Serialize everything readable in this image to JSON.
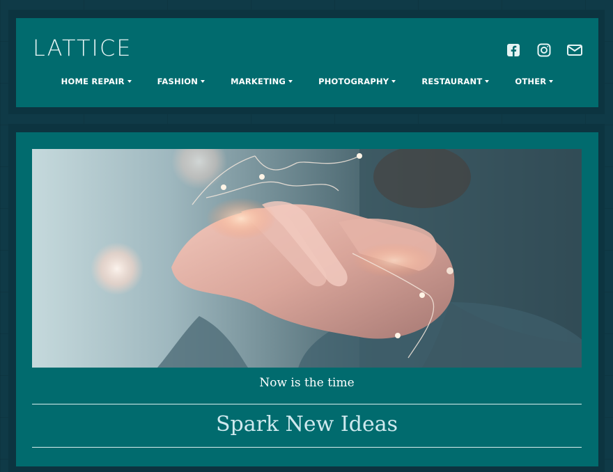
{
  "site": {
    "logo": "LATTICE"
  },
  "social": [
    {
      "icon": "facebook-icon"
    },
    {
      "icon": "instagram-icon"
    },
    {
      "icon": "email-icon"
    }
  ],
  "nav": {
    "items": [
      {
        "label": "HOME REPAIR"
      },
      {
        "label": "FASHION"
      },
      {
        "label": "MARKETING"
      },
      {
        "label": "PHOTOGRAPHY"
      },
      {
        "label": "RESTAURANT"
      },
      {
        "label": "OTHER"
      }
    ]
  },
  "hero": {
    "caption": "Now is the time",
    "headline": "Spark New Ideas"
  },
  "colors": {
    "background": "#0f3a47",
    "panel": "#016b6e",
    "text": "#ffffff"
  }
}
